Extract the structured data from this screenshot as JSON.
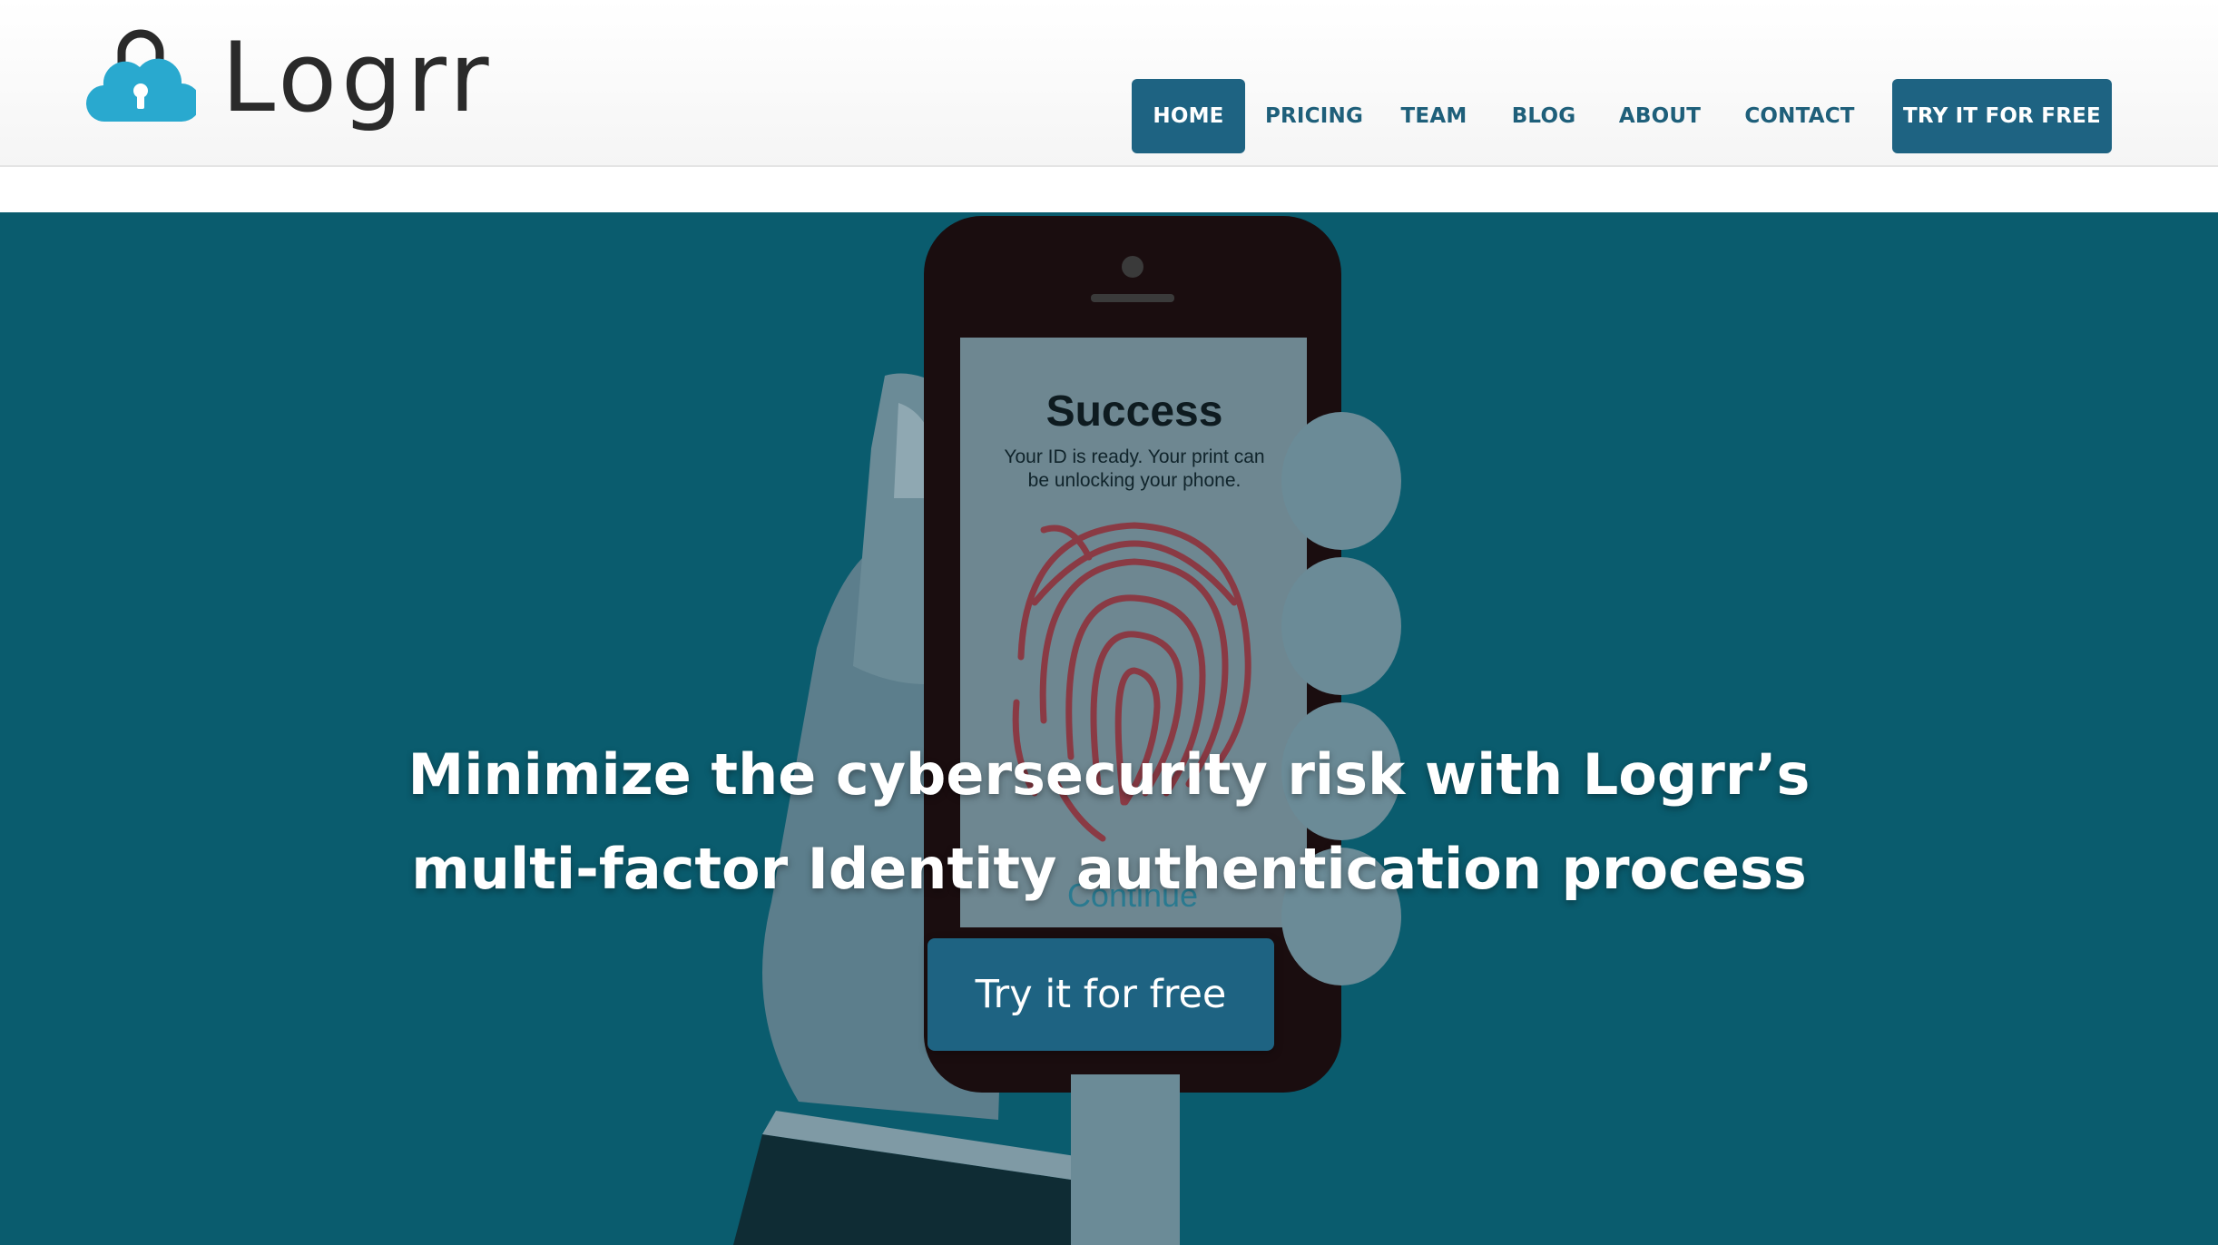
{
  "brand": {
    "name": "Logrr",
    "icon": "cloud-lock-icon",
    "icon_color": "#29a9cf"
  },
  "nav": {
    "items": [
      {
        "label": "HOME",
        "active": true
      },
      {
        "label": "PRICING"
      },
      {
        "label": "TEAM"
      },
      {
        "label": "BLOG"
      },
      {
        "label": "ABOUT"
      },
      {
        "label": "CONTACT"
      }
    ],
    "cta_label": "TRY IT FOR FREE"
  },
  "hero": {
    "title_line1": "Minimize the cybersecurity risk with Logrr’s",
    "title_line2": "multi-factor Identity authentication process",
    "cta_label": "Try it for free",
    "phone_screen": {
      "heading": "Success",
      "message_line1": "Your ID is ready. Your print can",
      "message_line2": "be unlocking your phone.",
      "continue_label": "Continue"
    }
  },
  "colors": {
    "accent": "#1e6382",
    "hero_background": "#0a5c6e",
    "fingerprint": "#c4202a"
  }
}
